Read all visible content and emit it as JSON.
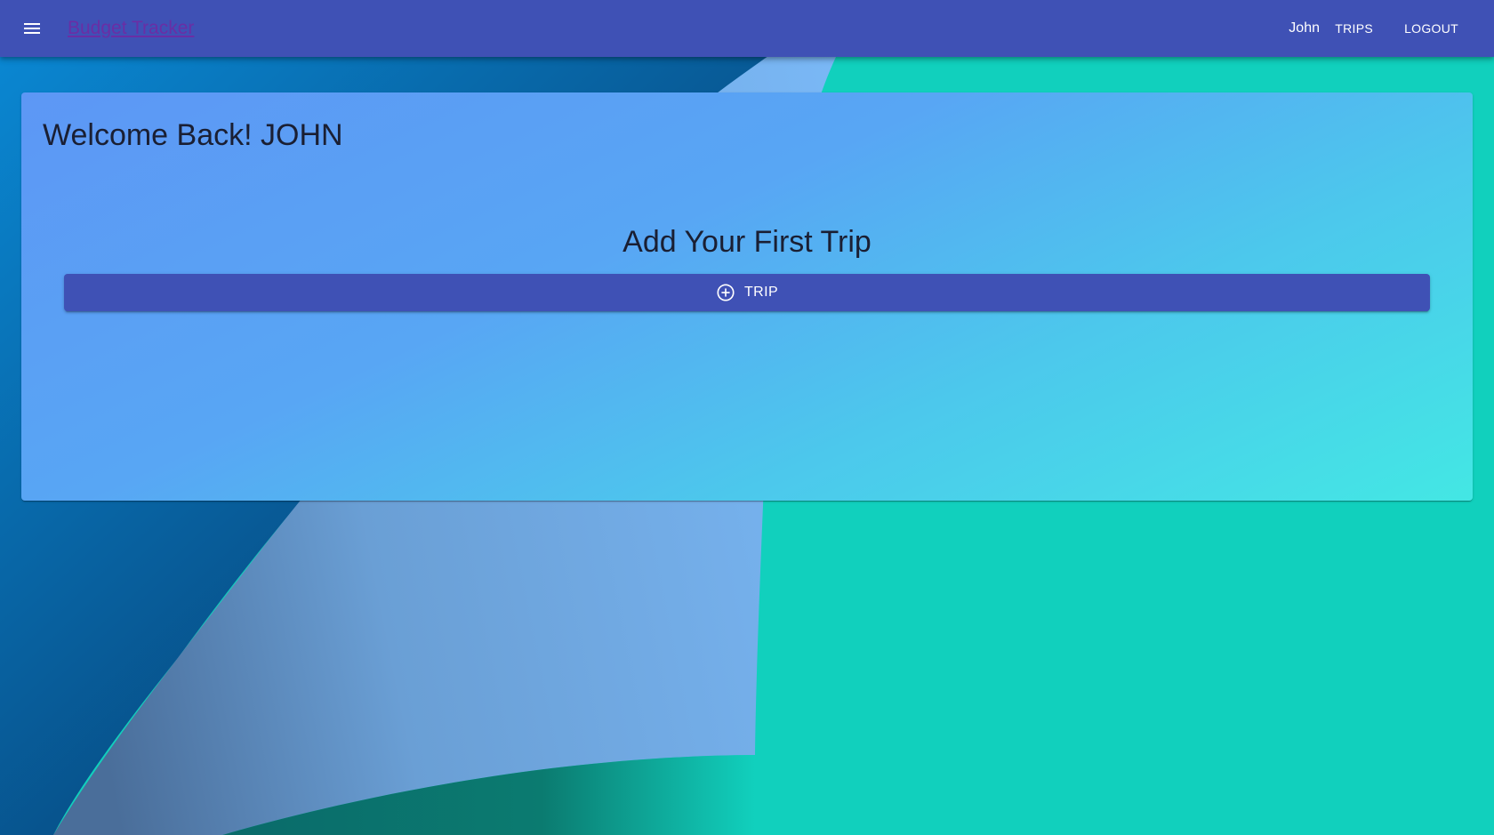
{
  "app": {
    "title": "Budget Tracker",
    "menu_icon": "menu-icon"
  },
  "nav": {
    "user_name": "John",
    "trips_label": "TRIPS",
    "logout_label": "LOGOUT"
  },
  "main": {
    "welcome_heading": "Welcome Back! JOHN",
    "empty_heading": "Add Your First Trip",
    "add_trip_label": "TRIP",
    "add_trip_icon": "add-circle-outline-icon"
  },
  "colors": {
    "appbar": "#3f51b5",
    "brand_link": "#6a2ea5",
    "button": "#3f51b5",
    "background_teal": "#11d0bd"
  }
}
